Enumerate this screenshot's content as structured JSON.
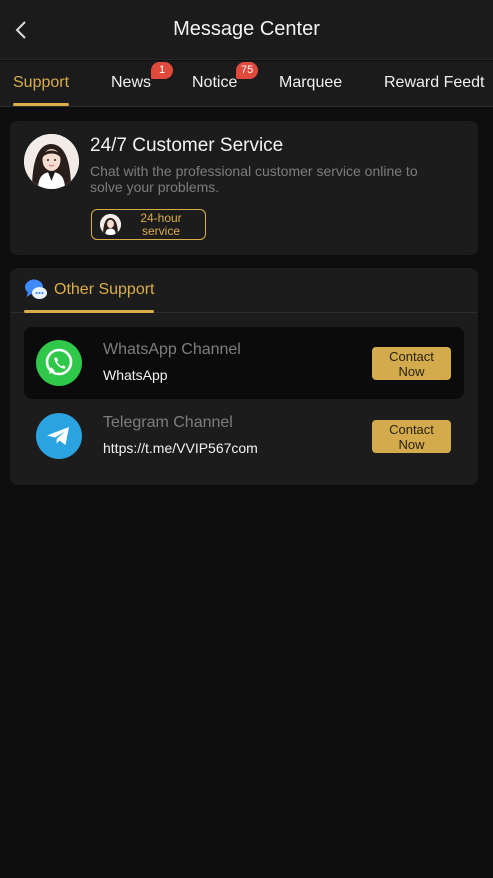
{
  "header": {
    "title": "Message Center",
    "back_icon": "chevron-left-icon"
  },
  "tabs": [
    {
      "label": "Support",
      "active": true
    },
    {
      "label": "News",
      "badge": "1"
    },
    {
      "label": "Notice",
      "badge": "75"
    },
    {
      "label": "Marquee"
    },
    {
      "label": "Reward Feedt"
    }
  ],
  "customer_service": {
    "title": "24/7 Customer Service",
    "description": "Chat with the professional customer service online to solve your problems.",
    "hours_label_line1": "24-hour",
    "hours_label_line2": "service"
  },
  "other_support": {
    "title": "Other Support",
    "icon": "chat-bubbles-icon",
    "channels": [
      {
        "name": "WhatsApp Channel",
        "value": "WhatsApp",
        "button_line1": "Contact",
        "button_line2": "Now",
        "icon": "whatsapp-icon"
      },
      {
        "name": "Telegram Channel",
        "value": "https://t.me/VVIP567com",
        "button_line1": "Contact",
        "button_line2": "Now",
        "icon": "telegram-icon"
      }
    ]
  },
  "colors": {
    "accent": "#d9ad4a",
    "background": "#0e0e0e",
    "card": "#1c1c1c",
    "badge": "#e04a3d",
    "whatsapp": "#2fc84a",
    "telegram": "#2aa3e0"
  }
}
